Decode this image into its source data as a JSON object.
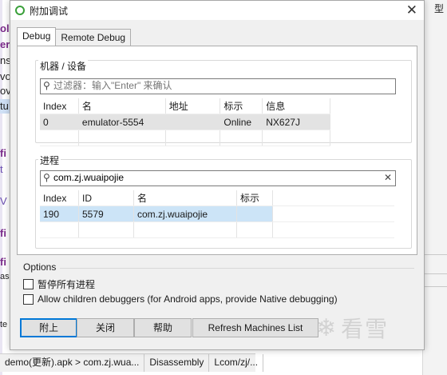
{
  "dialog": {
    "title": "附加调试",
    "close_glyph": "✕",
    "tabs": [
      {
        "label": "Debug",
        "active": true
      },
      {
        "label": "Remote Debug",
        "active": false
      }
    ],
    "machines": {
      "group_label": "机器 / 设备",
      "filter_placeholder": "过滤器：输入\"Enter\" 来确认",
      "columns": [
        "Index",
        "名",
        "地址",
        "标示",
        "信息"
      ],
      "rows": [
        {
          "index": "0",
          "name": "emulator-5554",
          "address": "",
          "mark": "Online",
          "info": "NX627J"
        }
      ]
    },
    "process": {
      "group_label": "进程",
      "filter_value": "com.zj.wuaipojie",
      "clear_glyph": "✕",
      "columns": [
        "Index",
        "ID",
        "名",
        "标示"
      ],
      "rows": [
        {
          "index": "190",
          "id": "5579",
          "name": "com.zj.wuaipojie",
          "mark": ""
        }
      ]
    },
    "options": {
      "label": "Options",
      "pause_all": "暂停所有进程",
      "allow_children": "Allow children debuggers (for Android apps, provide Native debugging)"
    },
    "buttons": {
      "attach": "附上",
      "close": "关闭",
      "help": "帮助",
      "refresh": "Refresh Machines List"
    }
  },
  "background": {
    "left_fragments": [
      "oli",
      "er",
      "ns",
      "vo",
      "ov",
      "tu",
      "fi",
      "t",
      "V",
      "fi",
      "fi",
      "as",
      "te"
    ],
    "right_top": "型",
    "status_items": [
      "demo(更新).apk > com.zj.wua...",
      "Disassembly",
      "Lcom/zj/..."
    ]
  },
  "watermark": {
    "text": "看雪",
    "icon": "snowflake-icon"
  },
  "colors": {
    "accent": "#0078d7",
    "selection_blue": "#cce4f7",
    "selection_gray": "#e3e3e3",
    "app_icon_green": "#3aa03a"
  }
}
